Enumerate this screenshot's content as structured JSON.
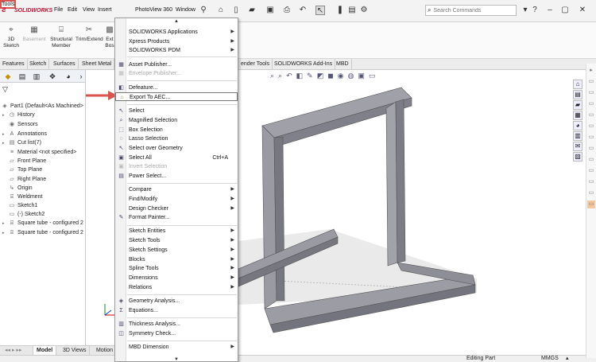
{
  "app": {
    "brand": "SOLIDWORKS"
  },
  "menubar": {
    "file": "File",
    "edit": "Edit",
    "view": "View",
    "insert": "Insert",
    "tools": "Tools",
    "photoview": "PhotoView 360",
    "window": "Window"
  },
  "search": {
    "placeholder": "Search Commands"
  },
  "commands": [
    {
      "label": "3D\nSketch",
      "icon": "3d-sketch-icon",
      "enabled": true
    },
    {
      "label": "Basement",
      "icon": "basement-icon",
      "enabled": false
    },
    {
      "label": "Structural\nMember",
      "icon": "structural-member-icon",
      "enabled": true
    },
    {
      "label": "Trim/Extend",
      "icon": "trim-extend-icon",
      "enabled": true
    },
    {
      "label": "Ext\nBos",
      "icon": "extruded-boss-icon",
      "enabled": true
    }
  ],
  "tabs": [
    "Features",
    "Sketch",
    "Surfaces",
    "Sheet Metal",
    "ender Tools",
    "SOLIDWORKS Add-Ins",
    "MBD"
  ],
  "tree": {
    "filter_icon": "filter-icon",
    "items": [
      {
        "label": "Part1  (Default<As Machined>",
        "icon": "part-icon",
        "expander": ""
      },
      {
        "label": "History",
        "icon": "history-icon",
        "expander": "▸"
      },
      {
        "label": "Sensors",
        "icon": "sensor-icon",
        "expander": ""
      },
      {
        "label": "Annotations",
        "icon": "annotation-icon",
        "expander": "▸"
      },
      {
        "label": "Cut list(7)",
        "icon": "cut-list-icon",
        "expander": "▸"
      },
      {
        "label": "Material <not specified>",
        "icon": "material-icon",
        "expander": ""
      },
      {
        "label": "Front Plane",
        "icon": "plane-icon",
        "expander": ""
      },
      {
        "label": "Top Plane",
        "icon": "plane-icon",
        "expander": ""
      },
      {
        "label": "Right Plane",
        "icon": "plane-icon",
        "expander": ""
      },
      {
        "label": "Origin",
        "icon": "origin-icon",
        "expander": ""
      },
      {
        "label": "Weldment",
        "icon": "weldment-icon",
        "expander": ""
      },
      {
        "label": "Sketch1",
        "icon": "sketch-icon",
        "expander": ""
      },
      {
        "label": "(-) Sketch2",
        "icon": "sketch-icon",
        "expander": ""
      },
      {
        "label": "Square tube - configured 2",
        "icon": "structural-member-icon",
        "expander": "▸"
      },
      {
        "label": "Square tube - configured 2",
        "icon": "structural-member-icon",
        "expander": "▸"
      }
    ]
  },
  "bottom_tabs": [
    "Model",
    "3D Views",
    "Motion"
  ],
  "status": {
    "mode": "Editing Part",
    "units": "MMGS"
  },
  "tools_menu": {
    "items": [
      {
        "label": "SOLIDWORKS Applications",
        "submenu": true,
        "enabled": true
      },
      {
        "label": "Xpress Products",
        "submenu": true,
        "enabled": true
      },
      {
        "label": "SOLIDWORKS PDM",
        "submenu": true,
        "enabled": true
      },
      {
        "sep": true
      },
      {
        "label": "Asset Publisher...",
        "icon": "asset-publisher-icon",
        "enabled": true
      },
      {
        "label": "Envelope Publisher...",
        "icon": "envelope-publisher-icon",
        "enabled": false
      },
      {
        "sep": true
      },
      {
        "label": "Defeature...",
        "icon": "defeature-icon",
        "enabled": true
      },
      {
        "label": "Export To AEC...",
        "icon": "export-aec-icon",
        "enabled": true,
        "highlight": true
      },
      {
        "sep": true
      },
      {
        "label": "Select",
        "icon": "select-icon",
        "enabled": true
      },
      {
        "label": "Magnified Selection",
        "icon": "magnified-selection-icon",
        "enabled": true
      },
      {
        "label": "Box Selection",
        "icon": "box-selection-icon",
        "enabled": true
      },
      {
        "label": "Lasso Selection",
        "icon": "lasso-selection-icon",
        "enabled": true
      },
      {
        "label": "Select over Geometry",
        "icon": "select-over-geometry-icon",
        "enabled": true
      },
      {
        "label": "Select All",
        "icon": "select-all-icon",
        "enabled": true,
        "shortcut": "Ctrl+A"
      },
      {
        "label": "Invert Selection",
        "icon": "invert-selection-icon",
        "enabled": false
      },
      {
        "label": "Power Select...",
        "icon": "power-select-icon",
        "enabled": true
      },
      {
        "sep": true
      },
      {
        "label": "Compare",
        "submenu": true,
        "enabled": true
      },
      {
        "label": "Find/Modify",
        "submenu": true,
        "enabled": true
      },
      {
        "label": "Design Checker",
        "submenu": true,
        "enabled": true
      },
      {
        "label": "Format Painter...",
        "icon": "format-painter-icon",
        "enabled": true
      },
      {
        "sep": true
      },
      {
        "label": "Sketch Entities",
        "submenu": true,
        "enabled": true
      },
      {
        "label": "Sketch Tools",
        "submenu": true,
        "enabled": true
      },
      {
        "label": "Sketch Settings",
        "submenu": true,
        "enabled": true
      },
      {
        "label": "Blocks",
        "submenu": true,
        "enabled": true
      },
      {
        "label": "Spline Tools",
        "submenu": true,
        "enabled": true
      },
      {
        "label": "Dimensions",
        "submenu": true,
        "enabled": true
      },
      {
        "label": "Relations",
        "submenu": true,
        "enabled": true
      },
      {
        "sep": true
      },
      {
        "label": "Geometry Analysis...",
        "icon": "geometry-analysis-icon",
        "enabled": true
      },
      {
        "label": "Equations...",
        "icon": "equations-icon",
        "enabled": true
      },
      {
        "sep": true
      },
      {
        "label": "Thickness Analysis...",
        "icon": "thickness-analysis-icon",
        "enabled": true
      },
      {
        "label": "Symmetry Check...",
        "icon": "symmetry-check-icon",
        "enabled": true
      },
      {
        "sep": true
      },
      {
        "label": "MBD Dimension",
        "submenu": true,
        "enabled": true
      }
    ]
  },
  "colors": {
    "accent_red": "#d9534f",
    "part_gray": "#9a9aa0"
  }
}
